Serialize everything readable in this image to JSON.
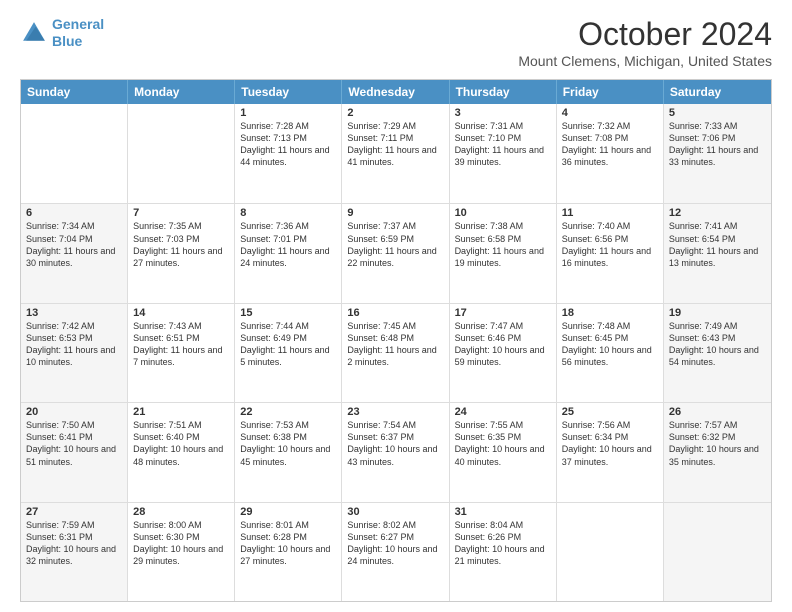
{
  "header": {
    "logo_line1": "General",
    "logo_line2": "Blue",
    "month": "October 2024",
    "location": "Mount Clemens, Michigan, United States"
  },
  "weekdays": [
    "Sunday",
    "Monday",
    "Tuesday",
    "Wednesday",
    "Thursday",
    "Friday",
    "Saturday"
  ],
  "rows": [
    [
      {
        "day": "",
        "info": "",
        "shaded": false
      },
      {
        "day": "",
        "info": "",
        "shaded": false
      },
      {
        "day": "1",
        "info": "Sunrise: 7:28 AM\nSunset: 7:13 PM\nDaylight: 11 hours and 44 minutes.",
        "shaded": false
      },
      {
        "day": "2",
        "info": "Sunrise: 7:29 AM\nSunset: 7:11 PM\nDaylight: 11 hours and 41 minutes.",
        "shaded": false
      },
      {
        "day": "3",
        "info": "Sunrise: 7:31 AM\nSunset: 7:10 PM\nDaylight: 11 hours and 39 minutes.",
        "shaded": false
      },
      {
        "day": "4",
        "info": "Sunrise: 7:32 AM\nSunset: 7:08 PM\nDaylight: 11 hours and 36 minutes.",
        "shaded": false
      },
      {
        "day": "5",
        "info": "Sunrise: 7:33 AM\nSunset: 7:06 PM\nDaylight: 11 hours and 33 minutes.",
        "shaded": true
      }
    ],
    [
      {
        "day": "6",
        "info": "Sunrise: 7:34 AM\nSunset: 7:04 PM\nDaylight: 11 hours and 30 minutes.",
        "shaded": true
      },
      {
        "day": "7",
        "info": "Sunrise: 7:35 AM\nSunset: 7:03 PM\nDaylight: 11 hours and 27 minutes.",
        "shaded": false
      },
      {
        "day": "8",
        "info": "Sunrise: 7:36 AM\nSunset: 7:01 PM\nDaylight: 11 hours and 24 minutes.",
        "shaded": false
      },
      {
        "day": "9",
        "info": "Sunrise: 7:37 AM\nSunset: 6:59 PM\nDaylight: 11 hours and 22 minutes.",
        "shaded": false
      },
      {
        "day": "10",
        "info": "Sunrise: 7:38 AM\nSunset: 6:58 PM\nDaylight: 11 hours and 19 minutes.",
        "shaded": false
      },
      {
        "day": "11",
        "info": "Sunrise: 7:40 AM\nSunset: 6:56 PM\nDaylight: 11 hours and 16 minutes.",
        "shaded": false
      },
      {
        "day": "12",
        "info": "Sunrise: 7:41 AM\nSunset: 6:54 PM\nDaylight: 11 hours and 13 minutes.",
        "shaded": true
      }
    ],
    [
      {
        "day": "13",
        "info": "Sunrise: 7:42 AM\nSunset: 6:53 PM\nDaylight: 11 hours and 10 minutes.",
        "shaded": true
      },
      {
        "day": "14",
        "info": "Sunrise: 7:43 AM\nSunset: 6:51 PM\nDaylight: 11 hours and 7 minutes.",
        "shaded": false
      },
      {
        "day": "15",
        "info": "Sunrise: 7:44 AM\nSunset: 6:49 PM\nDaylight: 11 hours and 5 minutes.",
        "shaded": false
      },
      {
        "day": "16",
        "info": "Sunrise: 7:45 AM\nSunset: 6:48 PM\nDaylight: 11 hours and 2 minutes.",
        "shaded": false
      },
      {
        "day": "17",
        "info": "Sunrise: 7:47 AM\nSunset: 6:46 PM\nDaylight: 10 hours and 59 minutes.",
        "shaded": false
      },
      {
        "day": "18",
        "info": "Sunrise: 7:48 AM\nSunset: 6:45 PM\nDaylight: 10 hours and 56 minutes.",
        "shaded": false
      },
      {
        "day": "19",
        "info": "Sunrise: 7:49 AM\nSunset: 6:43 PM\nDaylight: 10 hours and 54 minutes.",
        "shaded": true
      }
    ],
    [
      {
        "day": "20",
        "info": "Sunrise: 7:50 AM\nSunset: 6:41 PM\nDaylight: 10 hours and 51 minutes.",
        "shaded": true
      },
      {
        "day": "21",
        "info": "Sunrise: 7:51 AM\nSunset: 6:40 PM\nDaylight: 10 hours and 48 minutes.",
        "shaded": false
      },
      {
        "day": "22",
        "info": "Sunrise: 7:53 AM\nSunset: 6:38 PM\nDaylight: 10 hours and 45 minutes.",
        "shaded": false
      },
      {
        "day": "23",
        "info": "Sunrise: 7:54 AM\nSunset: 6:37 PM\nDaylight: 10 hours and 43 minutes.",
        "shaded": false
      },
      {
        "day": "24",
        "info": "Sunrise: 7:55 AM\nSunset: 6:35 PM\nDaylight: 10 hours and 40 minutes.",
        "shaded": false
      },
      {
        "day": "25",
        "info": "Sunrise: 7:56 AM\nSunset: 6:34 PM\nDaylight: 10 hours and 37 minutes.",
        "shaded": false
      },
      {
        "day": "26",
        "info": "Sunrise: 7:57 AM\nSunset: 6:32 PM\nDaylight: 10 hours and 35 minutes.",
        "shaded": true
      }
    ],
    [
      {
        "day": "27",
        "info": "Sunrise: 7:59 AM\nSunset: 6:31 PM\nDaylight: 10 hours and 32 minutes.",
        "shaded": true
      },
      {
        "day": "28",
        "info": "Sunrise: 8:00 AM\nSunset: 6:30 PM\nDaylight: 10 hours and 29 minutes.",
        "shaded": false
      },
      {
        "day": "29",
        "info": "Sunrise: 8:01 AM\nSunset: 6:28 PM\nDaylight: 10 hours and 27 minutes.",
        "shaded": false
      },
      {
        "day": "30",
        "info": "Sunrise: 8:02 AM\nSunset: 6:27 PM\nDaylight: 10 hours and 24 minutes.",
        "shaded": false
      },
      {
        "day": "31",
        "info": "Sunrise: 8:04 AM\nSunset: 6:26 PM\nDaylight: 10 hours and 21 minutes.",
        "shaded": false
      },
      {
        "day": "",
        "info": "",
        "shaded": false
      },
      {
        "day": "",
        "info": "",
        "shaded": true
      }
    ]
  ]
}
